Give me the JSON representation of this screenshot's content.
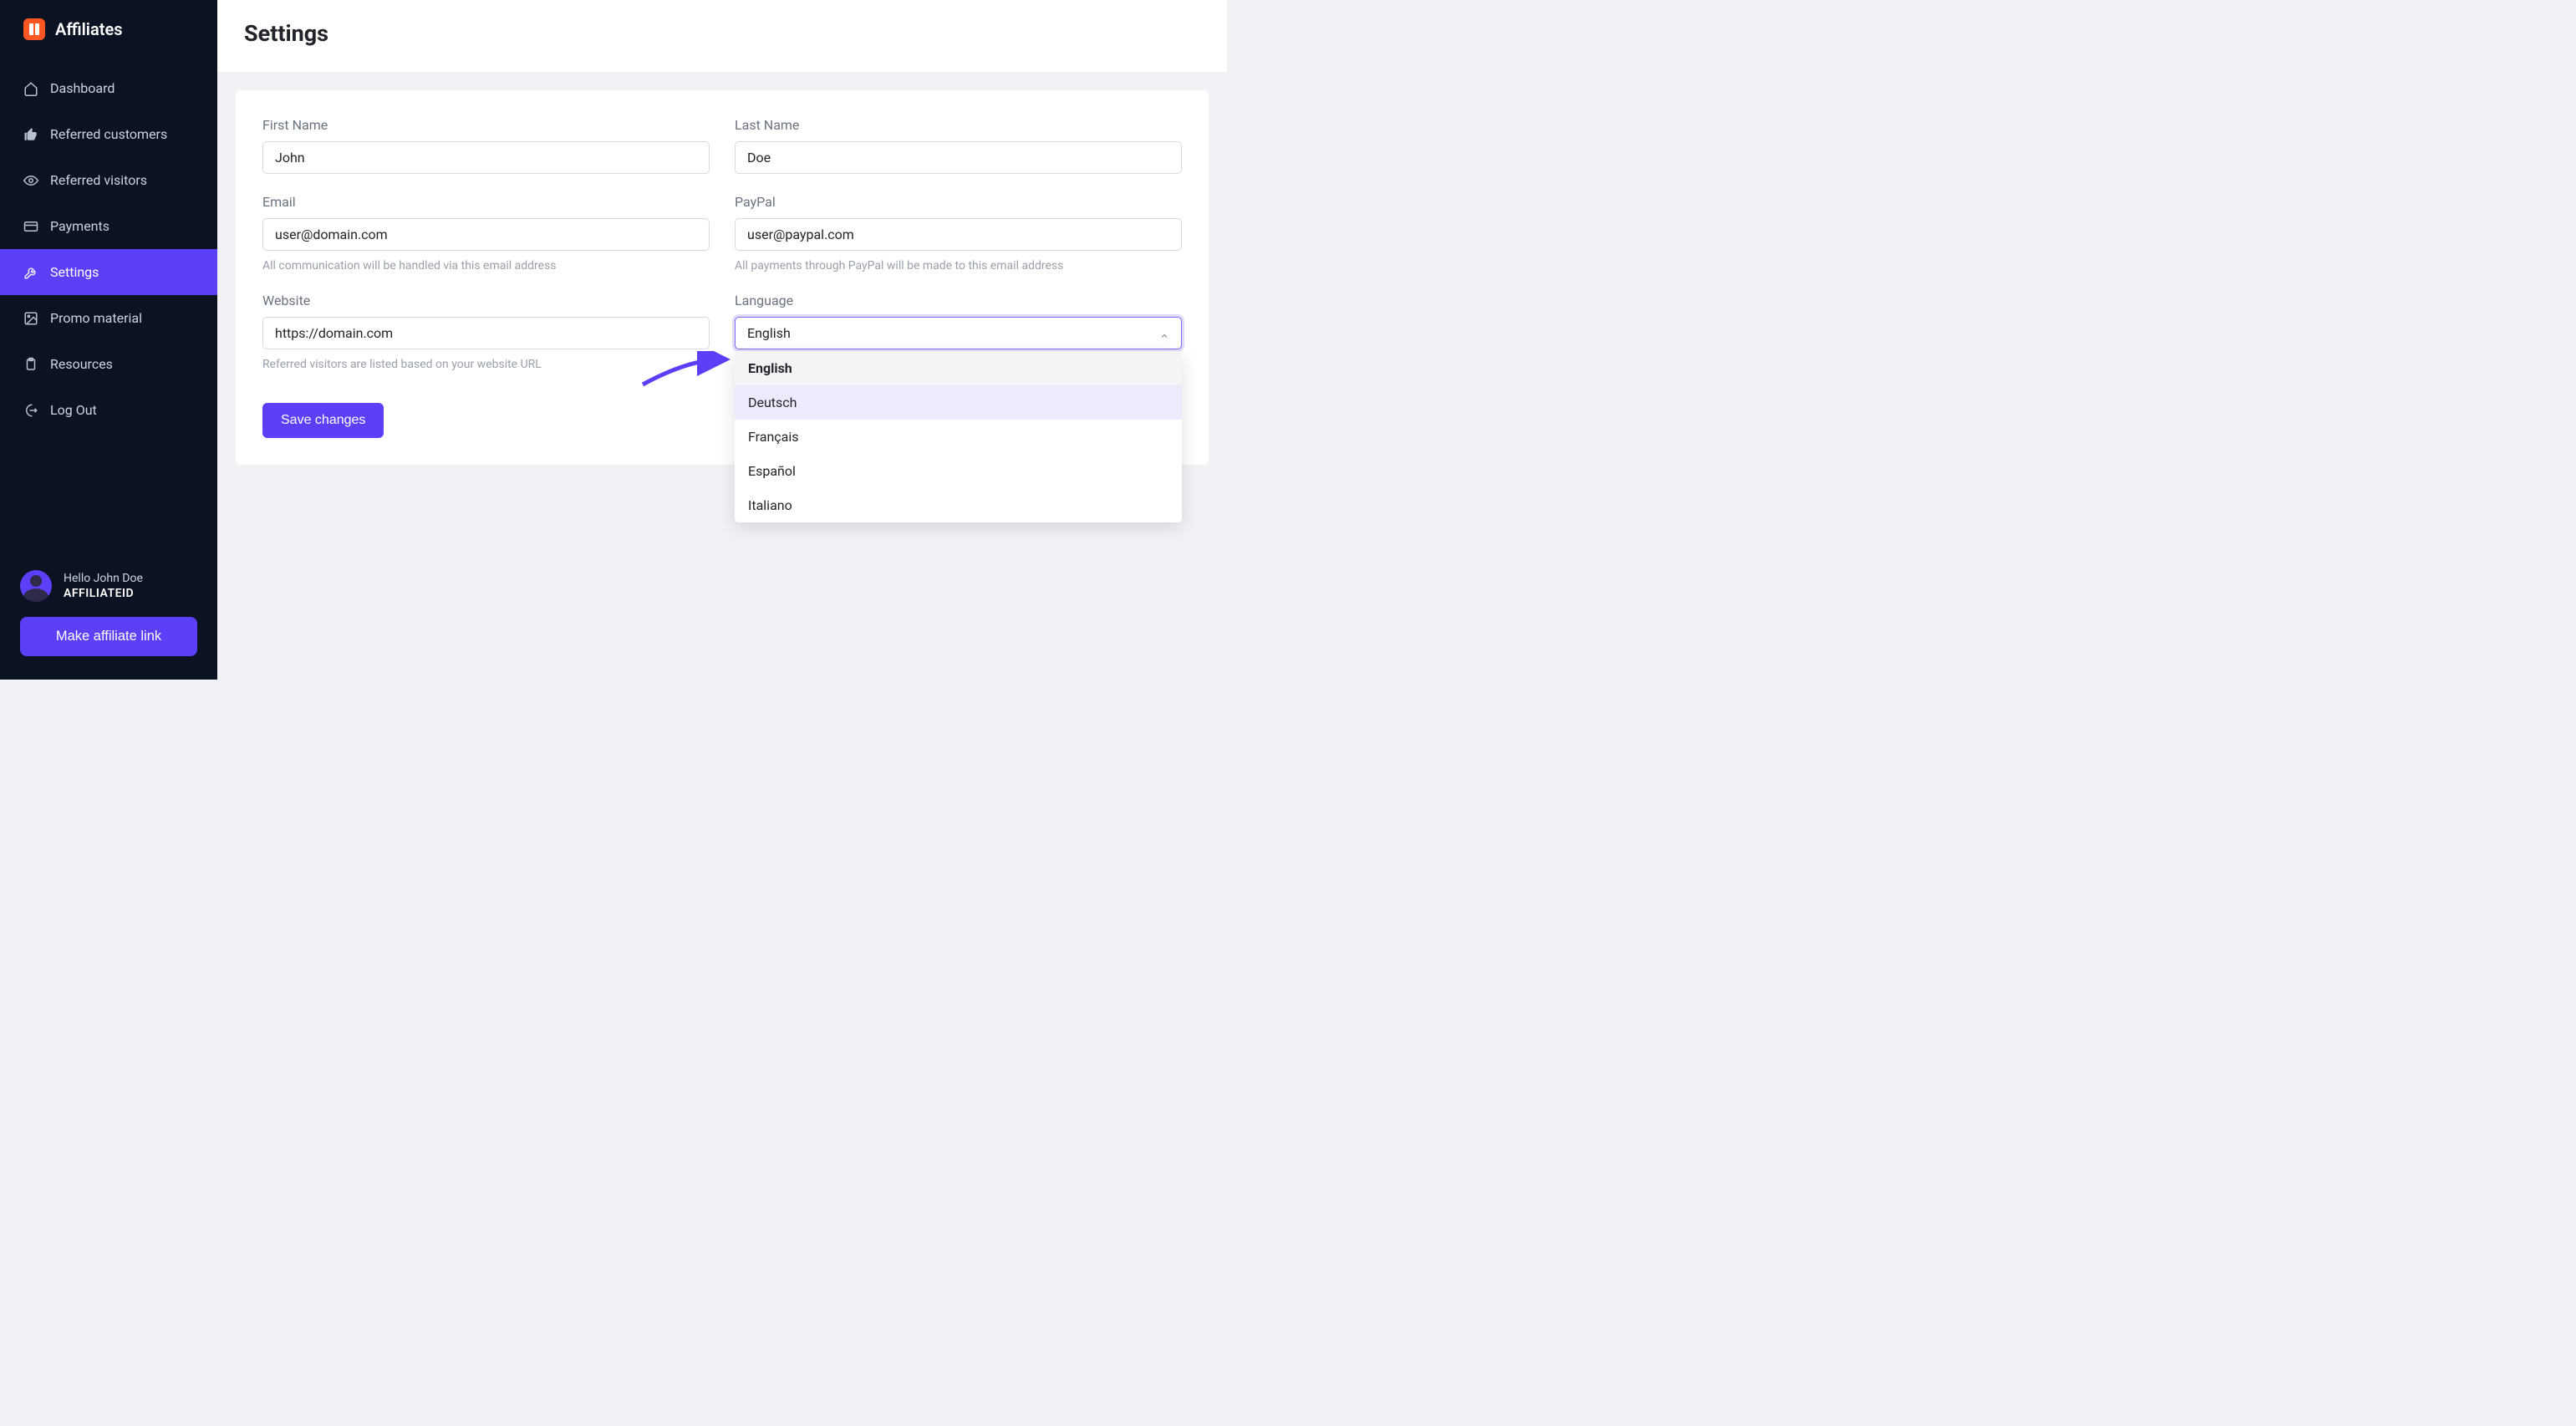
{
  "brand": {
    "title": "Affiliates"
  },
  "sidebar": {
    "items": [
      {
        "label": "Dashboard"
      },
      {
        "label": "Referred customers"
      },
      {
        "label": "Referred visitors"
      },
      {
        "label": "Payments"
      },
      {
        "label": "Settings"
      },
      {
        "label": "Promo material"
      },
      {
        "label": "Resources"
      },
      {
        "label": "Log Out"
      }
    ],
    "user": {
      "greeting": "Hello John Doe",
      "affiliate_id": "AFFILIATEID"
    },
    "link_button": "Make affiliate link"
  },
  "page": {
    "title": "Settings"
  },
  "form": {
    "first_name": {
      "label": "First Name",
      "value": "John"
    },
    "last_name": {
      "label": "Last Name",
      "value": "Doe"
    },
    "email": {
      "label": "Email",
      "value": "user@domain.com",
      "help": "All communication will be handled via this email address"
    },
    "paypal": {
      "label": "PayPal",
      "value": "user@paypal.com",
      "help": "All payments through PayPal will be made to this email address"
    },
    "website": {
      "label": "Website",
      "value": "https://domain.com",
      "help": "Referred visitors are listed based on your website URL"
    },
    "language": {
      "label": "Language",
      "value": "English",
      "options": [
        "English",
        "Deutsch",
        "Français",
        "Español",
        "Italiano"
      ],
      "selected_index": 0,
      "hovered_index": 1
    },
    "save_label": "Save changes"
  },
  "colors": {
    "sidebar_bg": "#0b1222",
    "accent": "#5b3ff9",
    "brand_orange": "#ff5623",
    "page_bg": "#f1f2f6"
  }
}
